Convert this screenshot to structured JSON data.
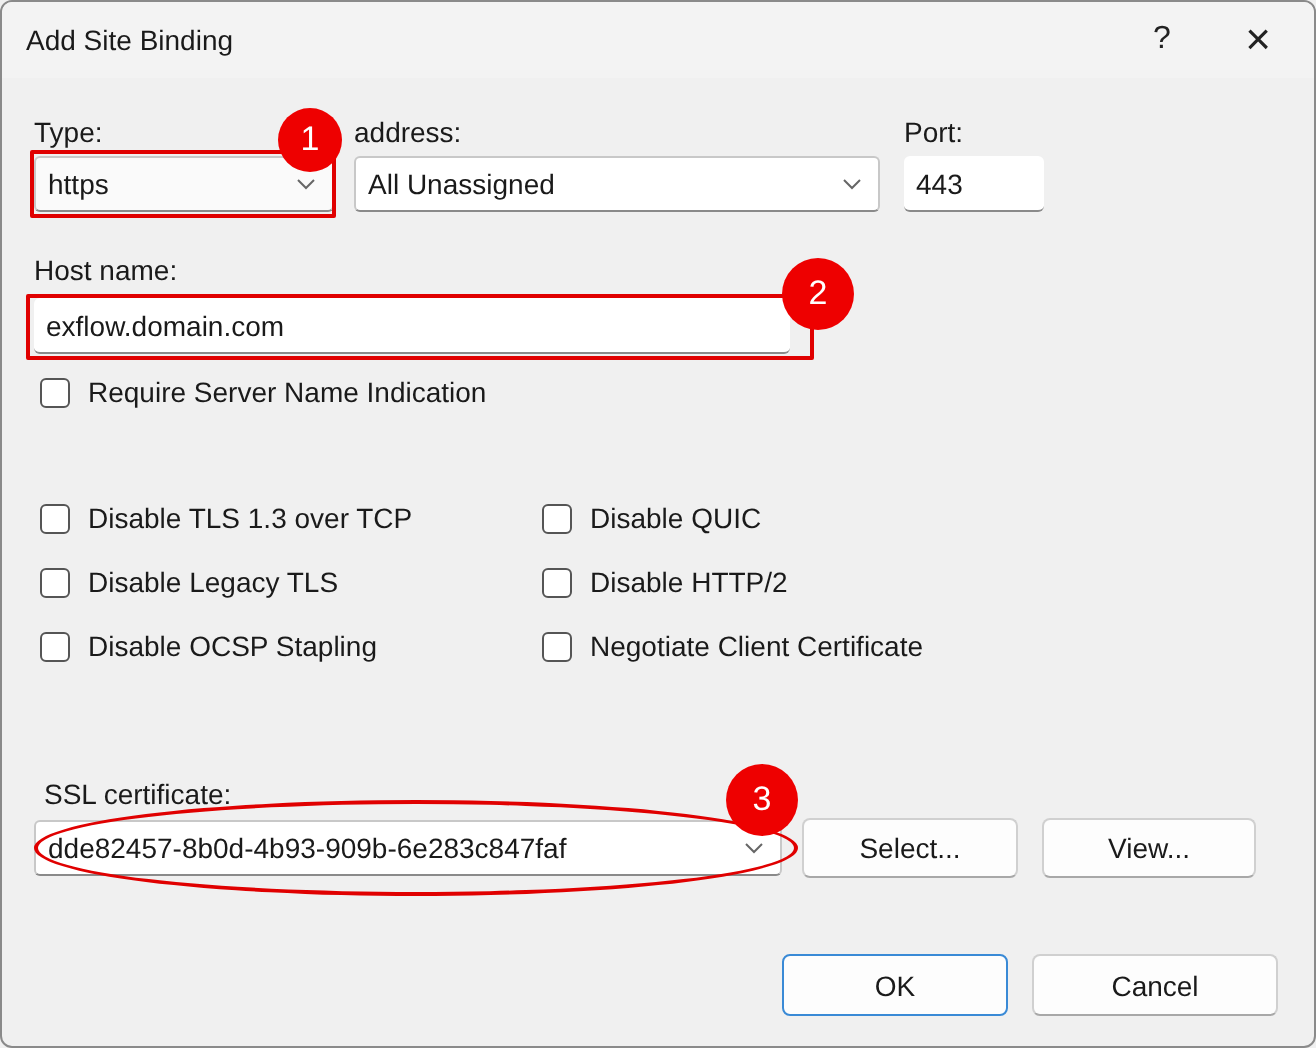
{
  "window": {
    "title": "Add Site Binding",
    "help": "?",
    "close": "×"
  },
  "type_field": {
    "label": "Type:",
    "value": "https",
    "annotation": {
      "number": "1",
      "kind": "rect"
    }
  },
  "ip_field": {
    "label": "address:",
    "value": "All Unassigned"
  },
  "port_field": {
    "label": "Port:",
    "value": "443"
  },
  "host_field": {
    "label": "Host name:",
    "value": "exflow.domain.com",
    "annotation": {
      "number": "2",
      "kind": "rect"
    }
  },
  "sni": {
    "label": "Require Server Name Indication",
    "checked": false
  },
  "options": [
    {
      "label": "Disable TLS 1.3 over TCP",
      "checked": false
    },
    {
      "label": "Disable QUIC",
      "checked": false
    },
    {
      "label": "Disable Legacy TLS",
      "checked": false
    },
    {
      "label": "Disable HTTP/2",
      "checked": false
    },
    {
      "label": "Disable OCSP Stapling",
      "checked": false
    },
    {
      "label": "Negotiate Client Certificate",
      "checked": false
    }
  ],
  "ssl": {
    "label": "SSL certificate:",
    "value": "dde82457-8b0d-4b93-909b-6e283c847faf",
    "annotation": {
      "number": "3",
      "kind": "ellipse"
    }
  },
  "ssl_buttons": [
    "Select...",
    "View..."
  ],
  "buttons": [
    {
      "label": "OK",
      "default": true
    },
    {
      "label": "Cancel",
      "default": false
    }
  ]
}
